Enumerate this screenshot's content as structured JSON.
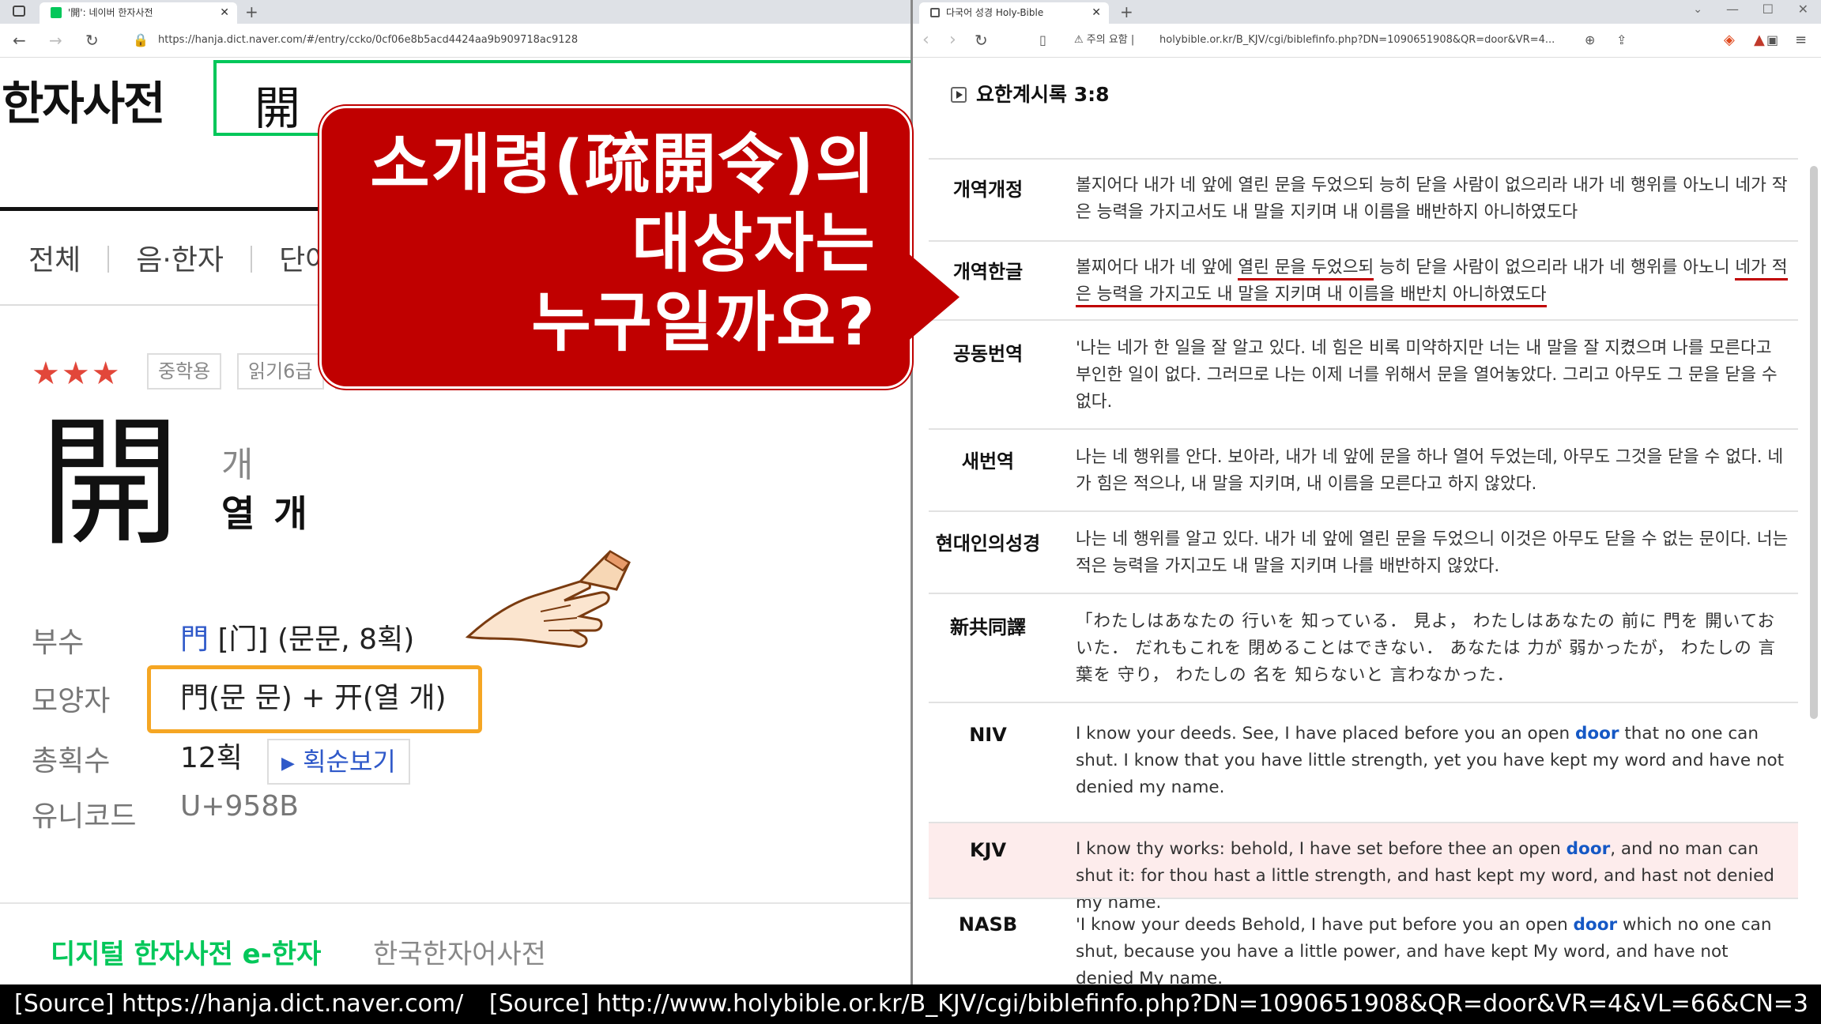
{
  "left_window": {
    "tab_title": "'開': 네이버 한자사전",
    "url": "https://hanja.dict.naver.com/#/entry/ccko/0cf06e8b5acd4424aa9b909718ac9128",
    "logo": "한자사전",
    "search_value": "開",
    "tabs": [
      "전체",
      "음·한자",
      "단어"
    ],
    "stars": "★★★",
    "badges": [
      "중학용",
      "읽기6급"
    ],
    "hanja": "開",
    "sound": "개",
    "meaning": "열 개",
    "info": [
      {
        "label": "부수",
        "value_a": "門",
        "value_b": "[门] (문문, 8획)"
      },
      {
        "label": "모양자",
        "value": "門(문 문) + 开(열 개)"
      },
      {
        "label": "총획수",
        "value": "12획"
      },
      {
        "label": "유니코드",
        "value": "U+958B"
      }
    ],
    "stroke_button": "획순보기",
    "bottom_tab_active": "디지털 한자사전 e-한자",
    "bottom_tab_inactive": "한국한자어사전"
  },
  "callout": {
    "line1": "소개령(疏開令)의",
    "line2": "대상자는",
    "line3": "누구일까요?"
  },
  "right_window": {
    "tab_title": "다국어 성경 Holy-Bible",
    "url_warning": "주의 요함",
    "url": "holybible.or.kr/B_KJV/cgi/biblefinfo.php?DN=1090651908&QR=door&VR=4...",
    "reference": "요한계시록 3:8",
    "verses": [
      {
        "name": "개역개정",
        "text": "볼지어다 내가 네 앞에 열린 문을 두었으되 능히 닫을 사람이 없으리라 내가 네 행위를 아노니 네가 작은 능력을 가지고서도 내 말을 지키며 내 이름을 배반하지 아니하였도다"
      },
      {
        "name": "개역한글",
        "t1": "볼찌어다 내가 네 앞에 ",
        "t2": "열린 문을 두었으되",
        "t3": " 능히 닫을 사람이 없으리라 내가 네 행위를 아노니 ",
        "t4": "네가 적은 능력을 가지고도 내 말을 지키며 내 이름을 배반치 아니하였도다"
      },
      {
        "name": "공동번역",
        "text": "'나는 네가 한 일을 잘 알고 있다. 네 힘은 비록 미약하지만 너는 내 말을 잘 지켰으며 나를 모른다고 부인한 일이 없다. 그러므로 나는 이제 너를 위해서 문을 열어놓았다. 그리고 아무도 그 문을 닫을 수 없다."
      },
      {
        "name": "새번역",
        "text": "나는 네 행위를 안다. 보아라, 내가 네 앞에 문을 하나 열어 두었는데, 아무도 그것을 닫을 수 없다. 네가 힘은 적으나, 내 말을 지키며, 내 이름을 모른다고 하지 않았다."
      },
      {
        "name": "현대인의성경",
        "text": "나는 네 행위를 알고 있다. 내가 네 앞에 열린 문을 두었으니 이것은 아무도 닫을 수 없는 문이다. 너는 적은 능력을 가지고도 내 말을 지키며 나를 배반하지 않았다."
      },
      {
        "name": "新共同譯",
        "text": "「わたしはあなたの 行いを 知っている． 見よ， わたしはあなたの 前に 門を 開いておいた． だれもこれを 閉めることはできない． あなたは 力が 弱かったが， わたしの 言葉を 守り， わたしの 名を 知らないと 言わなかった．"
      },
      {
        "name": "NIV",
        "a": "I know your deeds. See, I have placed before you an open ",
        "door": "door",
        "b": " that no one can shut. I know that you have little strength, yet you have kept my word and have not denied my name."
      },
      {
        "name": "KJV",
        "a": "I know thy works: behold, I have set before thee an open ",
        "door": "door",
        "b": ", and no man can shut it: for thou hast a little strength, and hast kept my word, and hast not denied my name."
      },
      {
        "name": "NASB",
        "a": "'I know your deeds Behold, I have put before you an open ",
        "door": "door",
        "b": " which no one can shut, because you have a little power, and have kept My word, and have not denied My name."
      }
    ]
  },
  "source_left": "[Source] https://hanja.dict.naver.com/",
  "source_right": "[Source] http://www.holybible.or.kr/B_KJV/cgi/biblefinfo.php?DN=1090651908&QR=door&VR=4&VL=66&CN=3",
  "colors": {
    "naver_green": "#03c75a",
    "callout_red": "#c00000",
    "door_blue": "#1558c5",
    "highlight_row": "#fdecec",
    "orange": "#f5a623"
  }
}
